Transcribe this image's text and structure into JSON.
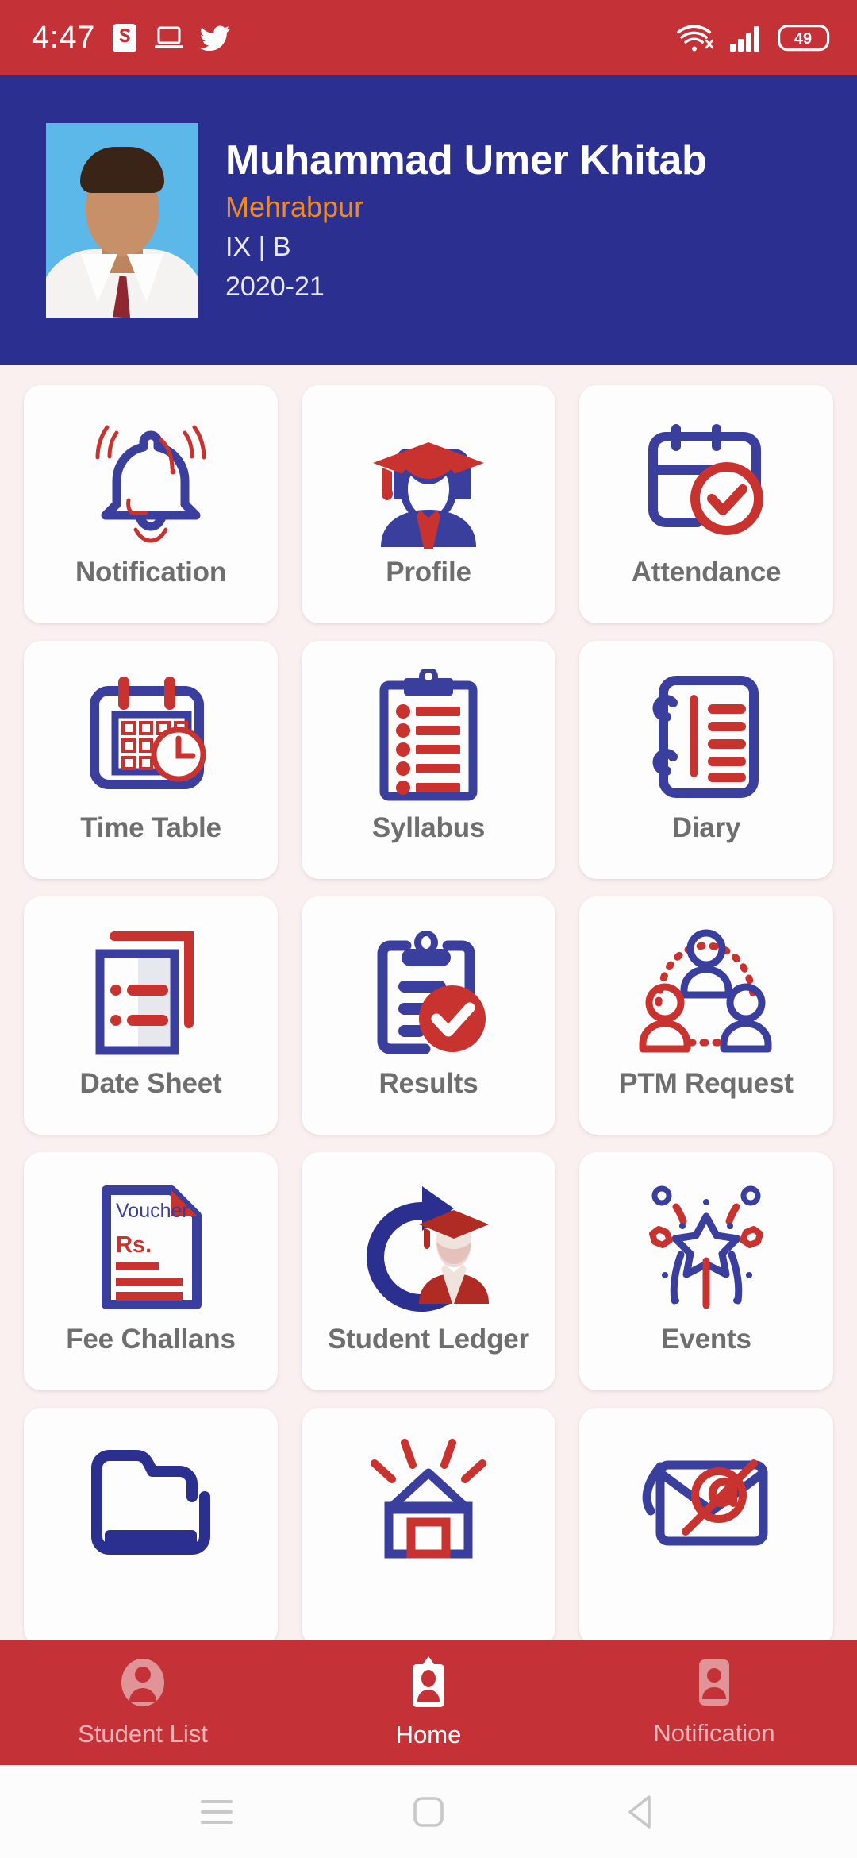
{
  "statusbar": {
    "time": "4:47",
    "battery_level": "49",
    "left_icons": [
      "s-app-icon",
      "laptop-icon",
      "twitter-icon"
    ],
    "right_icons": [
      "wifi-icon",
      "signal-icon",
      "battery-icon"
    ]
  },
  "header": {
    "student_name": "Muhammad Umer Khitab",
    "campus": "Mehrabpur",
    "class_section": "IX | B",
    "session": "2020-21",
    "avatar_icon": "student-photo",
    "bg_color": "#2B2F8F",
    "campus_color": "#F08A1E"
  },
  "grid": {
    "tiles": [
      {
        "label": "Notification",
        "icon": "bell-icon"
      },
      {
        "label": "Profile",
        "icon": "graduate-avatar-icon"
      },
      {
        "label": "Attendance",
        "icon": "calendar-check-icon"
      },
      {
        "label": "Time Table",
        "icon": "calendar-clock-icon"
      },
      {
        "label": "Syllabus",
        "icon": "clipboard-list-icon"
      },
      {
        "label": "Diary",
        "icon": "notebook-icon"
      },
      {
        "label": "Date Sheet",
        "icon": "documents-list-icon"
      },
      {
        "label": "Results",
        "icon": "clipboard-check-icon"
      },
      {
        "label": "PTM Request",
        "icon": "people-network-icon"
      },
      {
        "label": "Fee Challans",
        "icon": "voucher-icon"
      },
      {
        "label": "Student Ledger",
        "icon": "refresh-student-icon"
      },
      {
        "label": "Events",
        "icon": "fireworks-star-icon"
      },
      {
        "label": "",
        "icon": "folder-icon"
      },
      {
        "label": "",
        "icon": "notice-board-icon"
      },
      {
        "label": "",
        "icon": "email-icon"
      }
    ],
    "voucher_title": "Voucher",
    "voucher_currency": "Rs.",
    "label_color": "#6E6E6E",
    "tile_bg": "#FDFDFD",
    "page_bg": "#FAF0F0",
    "icon_blue": "#3A3E9C",
    "icon_red": "#C9332F"
  },
  "bottom_nav": {
    "items": [
      {
        "label": "Student List",
        "icon": "person-oval-icon",
        "active": false
      },
      {
        "label": "Home",
        "icon": "id-card-icon",
        "active": true
      },
      {
        "label": "Notification",
        "icon": "person-card-icon",
        "active": false
      }
    ],
    "bg_color": "#C43238",
    "active_color": "#FFFFFF",
    "inactive_color": "#EDB3B6"
  },
  "system_nav": {
    "buttons": [
      {
        "icon": "recents-menu-icon"
      },
      {
        "icon": "home-square-icon"
      },
      {
        "icon": "back-triangle-icon"
      }
    ]
  }
}
